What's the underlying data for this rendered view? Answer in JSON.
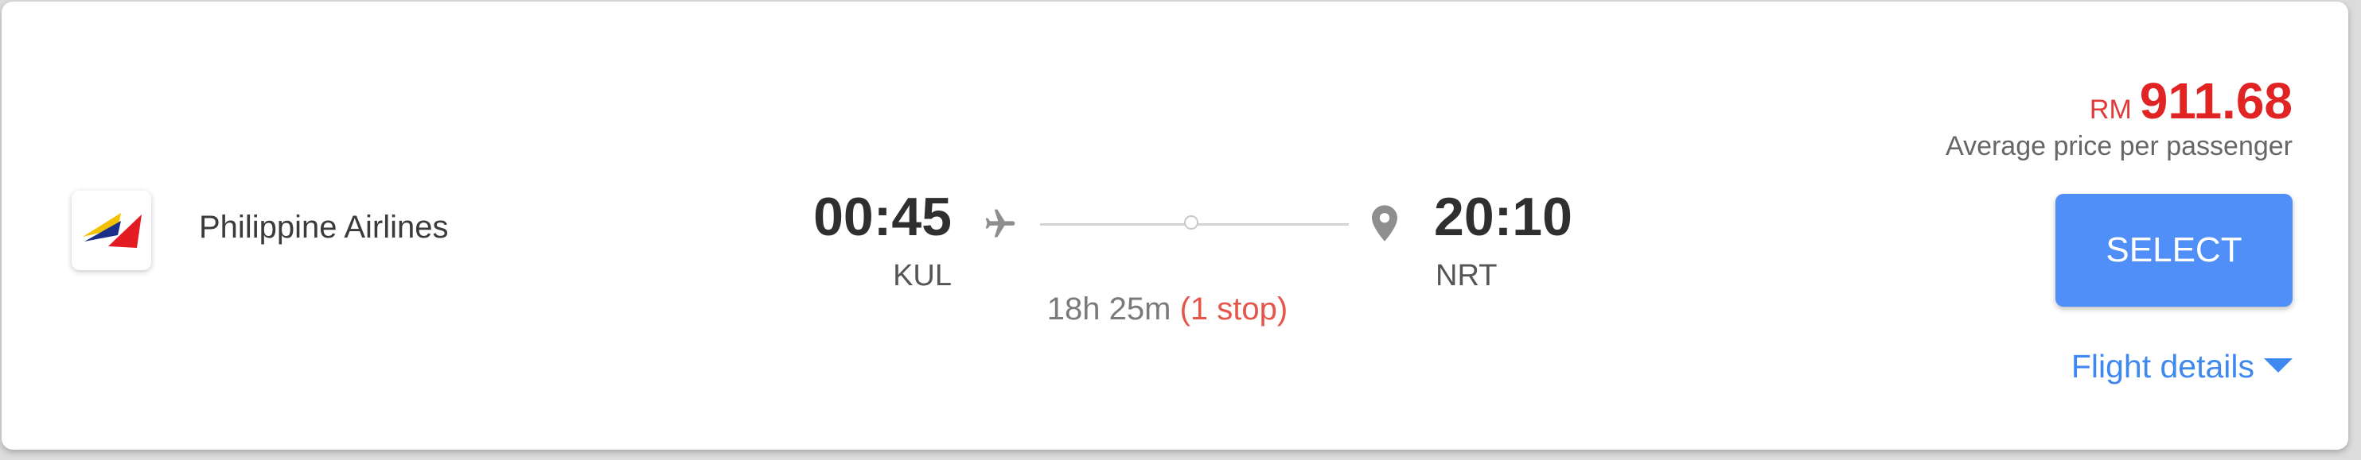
{
  "flight": {
    "airline": {
      "name": "Philippine Airlines",
      "logo_icon": "philippine-airlines-logo"
    },
    "departure": {
      "time": "00:45",
      "airport": "KUL"
    },
    "arrival": {
      "time": "20:10",
      "airport": "NRT"
    },
    "duration": "18h 25m",
    "stops": "(1 stop)",
    "icons": {
      "departure": "plane-icon",
      "arrival": "map-pin-icon",
      "details": "caret-down-icon"
    }
  },
  "price": {
    "currency": "RM",
    "amount": "911.68",
    "note": "Average price per passenger"
  },
  "actions": {
    "select_label": "SELECT",
    "details_label": "Flight details"
  },
  "colors": {
    "price": "#e02424",
    "stops": "#e5554a",
    "button": "#4f8ff7",
    "link": "#3f88f0"
  }
}
